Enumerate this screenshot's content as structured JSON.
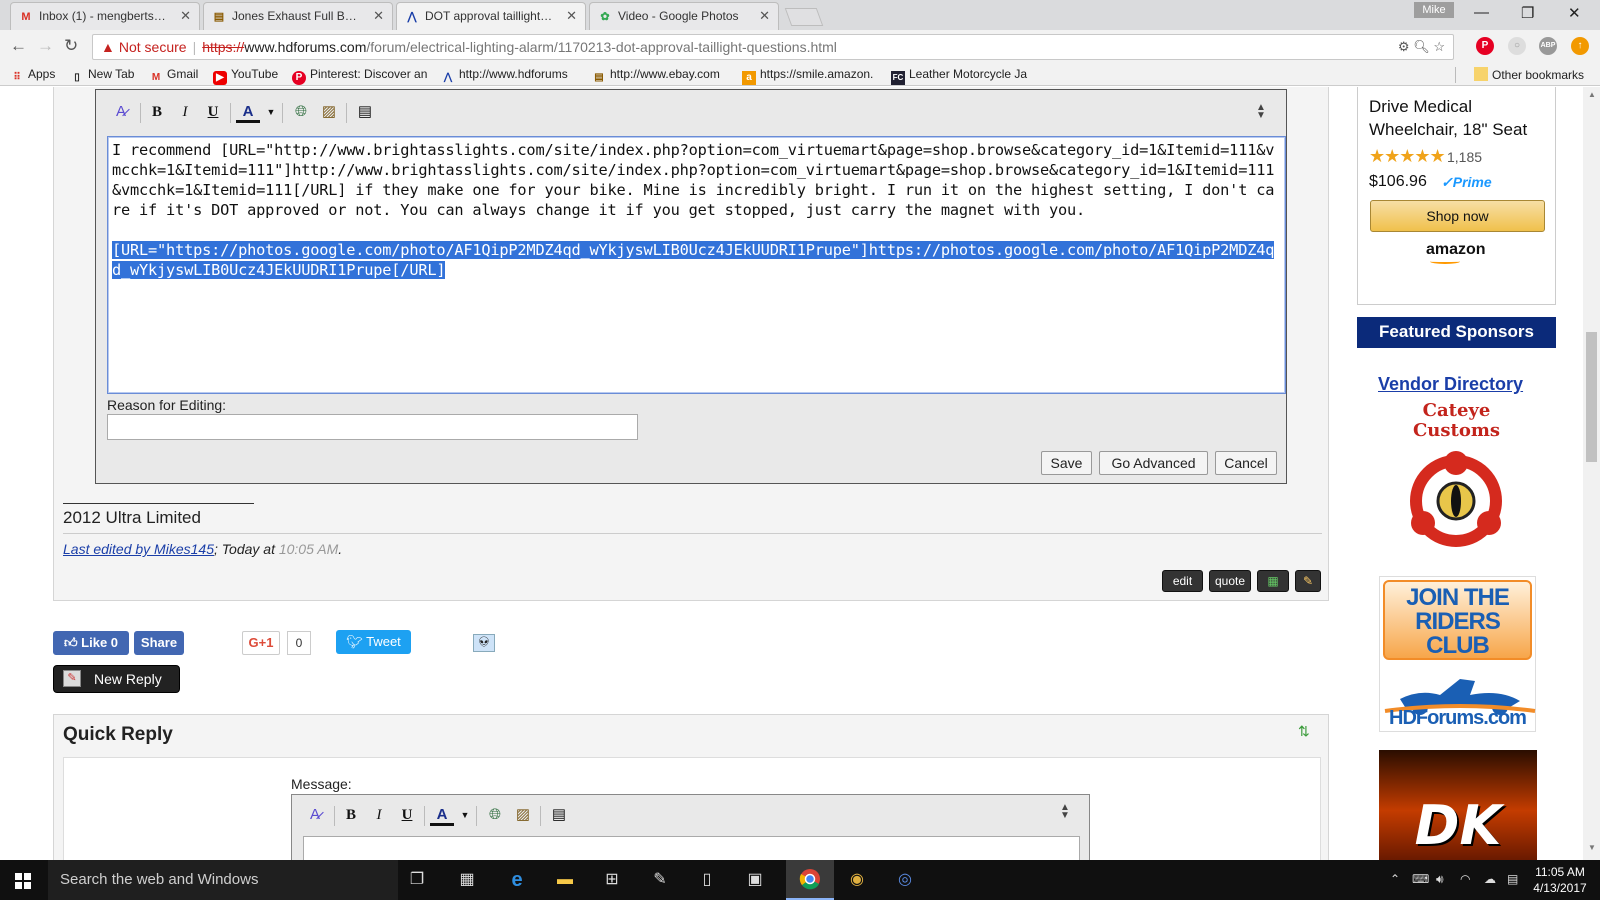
{
  "browser": {
    "tabs": [
      {
        "title": "Inbox (1) - mengberts70@",
        "favicon": "gmail-icon",
        "close": "✕"
      },
      {
        "title": "Jones Exhaust Full Boar S",
        "favicon": "ebay-icon",
        "close": "✕"
      },
      {
        "title": "DOT approval taillight qu",
        "favicon": "hdforums-icon",
        "close": "✕"
      },
      {
        "title": "Video - Google Photos",
        "favicon": "photos-icon",
        "close": "✕"
      }
    ],
    "profile": "Mike",
    "window_controls": {
      "minimize": "—",
      "maximize": "❐",
      "close": "✕"
    },
    "not_secure": "Not secure",
    "url": {
      "scheme": "https://",
      "host": "www.hdforums.com",
      "path": "/forum/electrical-lighting-alarm/1170213-dot-approval-taillight-questions.html"
    },
    "bookmarks": [
      {
        "label": "Apps",
        "icon": "apps-grid-icon"
      },
      {
        "label": "New Tab",
        "icon": "page-icon"
      },
      {
        "label": "Gmail",
        "icon": "gmail-icon"
      },
      {
        "label": "YouTube",
        "icon": "youtube-icon"
      },
      {
        "label": "Pinterest: Discover an",
        "icon": "pinterest-icon"
      },
      {
        "label": "http://www.hdforums",
        "icon": "hdforums-icon"
      },
      {
        "label": "http://www.ebay.com",
        "icon": "ebay-icon"
      },
      {
        "label": "https://smile.amazon.",
        "icon": "amazon-icon"
      },
      {
        "label": "Leather Motorcycle Ja",
        "icon": "fc-icon"
      }
    ],
    "other_bookmarks": "Other bookmarks"
  },
  "editor": {
    "text_line1": "I recommend [URL=\"http://www.brightasslights.com/site/index.php?option=com_virtuemart&page=shop.browse&category_id=1&Itemid=111&vmcchk=1&Itemid=111\"]http://www.brightasslights.com/site/index.php?option=com_virtuemart&page=shop.browse&category_id=1&Itemid=111&vmcchk=1&Itemid=111[/URL] if they make one for your bike.  Mine is incredibly bright.  I run it on the highest setting, I don't care if it's DOT approved or not.  You can always change it if you get stopped, just carry the magnet with you.",
    "text_selected": "[URL=\"https://photos.google.com/photo/AF1QipP2MDZ4qd_wYkjyswLIB0Ucz4JEkUUDRI1Prupe\"]https://photos.google.com/photo/AF1QipP2MDZ4qd_wYkjyswLIB0Ucz4JEkUUDRI1Prupe[/URL]",
    "reason_label": "Reason for Editing:",
    "reason_value": "",
    "save": "Save",
    "go_advanced": "Go Advanced",
    "cancel": "Cancel",
    "toolbar": {
      "bold": "B",
      "italic": "I",
      "underline": "U",
      "font_color": "A"
    }
  },
  "post": {
    "signature": "2012 Ultra Limited",
    "last_edited_prefix": "Last edited by Mikes145",
    "last_edited_mid": "; Today at ",
    "last_edited_time": "10:05 AM",
    "last_edited_end": ".",
    "buttons": {
      "edit": "edit",
      "quote": "quote"
    }
  },
  "social": {
    "like": "Like 0",
    "share": "Share",
    "gplus": "G+1",
    "gplus_count": "0",
    "tweet": "Tweet",
    "new_reply": "New Reply"
  },
  "quick_reply": {
    "title": "Quick Reply",
    "message_label": "Message:"
  },
  "sidebar": {
    "ad_title": "Drive Medical Wheelchair, 18\" Seat",
    "ad_stars": "★★★★★",
    "ad_count": "1,185",
    "ad_price": "$106.96",
    "ad_prime": "✓Prime",
    "ad_shop": "Shop now",
    "ad_brand": "amazon",
    "featured": "Featured Sponsors",
    "vendor_directory": "Vendor Directory",
    "sponsor1": "Cateye Customs",
    "sponsor2_banner": "JOIN THE RIDERS CLUB",
    "sponsor2_brand": "HDForums.com",
    "sponsor3": "DK"
  },
  "taskbar": {
    "search_placeholder": "Search the web and Windows",
    "time": "11:05 AM",
    "date": "4/13/2017"
  }
}
